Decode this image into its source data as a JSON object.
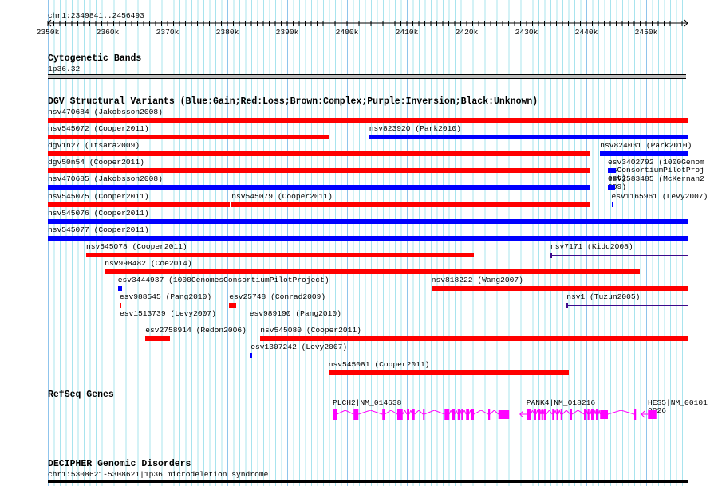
{
  "view": {
    "region_label": "chr1:2349841..2456493",
    "start_kb": 2349.841,
    "end_kb": 2456.493
  },
  "ruler": {
    "ticks": [
      "2350k",
      "2360k",
      "2370k",
      "2380k",
      "2390k",
      "2400k",
      "2410k",
      "2420k",
      "2430k",
      "2440k",
      "2450k"
    ]
  },
  "colors": {
    "gain": "#0000ff",
    "loss": "#ff0000",
    "inversion": "#3c0a8c",
    "gene": "#ff00ff",
    "grid_major": "#8fc4ec",
    "grid_minor": "#a8e4ee"
  },
  "tracks": {
    "cyto": {
      "title": "Cytogenetic Bands",
      "band": "1p36.32"
    },
    "dgv": {
      "title": "DGV Structural Variants (Blue:Gain;Red:Loss;Brown:Complex;Purple:Inversion;Black:Unknown)",
      "rows": [
        [
          {
            "label": "nsv470684 (Jakobsson2008)",
            "start": 2349.8,
            "end": 2457,
            "type": "loss"
          }
        ],
        [
          {
            "label": "nsv545072 (Cooper2011)",
            "start": 2349.8,
            "end": 2397.1,
            "type": "loss"
          },
          {
            "label": "nsv823920 (Park2010)",
            "start": 2403.7,
            "end": 2457,
            "type": "gain"
          }
        ],
        [
          {
            "label": "dgv1n27 (Itsara2009)",
            "start": 2349.8,
            "end": 2440.5,
            "type": "loss"
          },
          {
            "label": "nsv824031 (Park2010)",
            "start": 2442.3,
            "end": 2457,
            "type": "gain"
          }
        ],
        [
          {
            "label": "dgv50n54 (Cooper2011)",
            "start": 2349.8,
            "end": 2440.5,
            "type": "loss"
          },
          {
            "label": "esv3402792 (1000GenomesConsortiumPilotProject)",
            "start": 2443.6,
            "end": 2444.9,
            "type": "gain"
          }
        ],
        [
          {
            "label": "nsv470685 (Jakobsson2008)",
            "start": 2349.8,
            "end": 2440.5,
            "type": "gain"
          },
          {
            "label": "esv2583485 (McKernan2009)",
            "start": 2443.6,
            "end": 2444.8,
            "type": "gain"
          }
        ],
        [
          {
            "label": "nsv545075 (Cooper2011)",
            "start": 2349.8,
            "end": 2380.4,
            "type": "loss"
          },
          {
            "label": "nsv545079 (Cooper2011)",
            "start": 2380.7,
            "end": 2440.5,
            "type": "loss"
          },
          {
            "label": "esv1165961 (Levy2007)",
            "start": 2444.2,
            "end": 2444.5,
            "type": "gain"
          }
        ],
        [
          {
            "label": "nsv545076 (Cooper2011)",
            "start": 2349.8,
            "end": 2457,
            "type": "gain"
          }
        ],
        [
          {
            "label": "nsv545077 (Cooper2011)",
            "start": 2349.8,
            "end": 2457,
            "type": "gain"
          }
        ],
        [
          {
            "label": "nsv545078 (Cooper2011)",
            "start": 2356.4,
            "end": 2421.2,
            "type": "loss"
          },
          {
            "label": "nsv7171 (Kidd2008)",
            "start": 2434.0,
            "end": 2457,
            "type": "inversion"
          }
        ],
        [
          {
            "label": "nsv998482 (Coe2014)",
            "start": 2359.5,
            "end": 2448.9,
            "type": "loss"
          }
        ],
        [
          {
            "label": "esv3444937 (1000GenomesConsortiumPilotProject)",
            "start": 2361.7,
            "end": 2362.4,
            "type": "gain"
          },
          {
            "label": "nsv818222 (Wang2007)",
            "start": 2414.1,
            "end": 2457,
            "type": "loss"
          }
        ],
        [
          {
            "label": "esv988545 (Pang2010)",
            "start": 2362.0,
            "end": 2362.3,
            "type": "loss"
          },
          {
            "label": "esv25748 (Conrad2009)",
            "start": 2380.3,
            "end": 2381.5,
            "type": "loss"
          },
          {
            "label": "nsv1 (Tuzun2005)",
            "start": 2436.7,
            "end": 2457,
            "type": "inversion"
          }
        ],
        [
          {
            "label": "esv1513739 (Levy2007)",
            "start": 2362.0,
            "end": 2362.2,
            "type": "gain"
          },
          {
            "label": "esv989190 (Pang2010)",
            "start": 2383.7,
            "end": 2383.9,
            "type": "gain"
          }
        ],
        [
          {
            "label": "esv2758914 (Redon2006)",
            "start": 2366.3,
            "end": 2370.4,
            "type": "loss"
          },
          {
            "label": "nsv545080 (Cooper2011)",
            "start": 2385.5,
            "end": 2457,
            "type": "loss"
          }
        ],
        [
          {
            "label": "esv1307242 (Levy2007)",
            "start": 2383.9,
            "end": 2384.1,
            "type": "gain"
          }
        ],
        [
          {
            "label": "nsv545081 (Cooper2011)",
            "start": 2396.9,
            "end": 2437.0,
            "type": "loss"
          }
        ]
      ]
    },
    "refseq": {
      "title": "RefSeq Genes",
      "genes": [
        {
          "label": "PLCH2|NM_014638",
          "strand": "+",
          "exons": [
            [
              2397.6,
              2398.3
            ],
            [
              2401.1,
              2401.9
            ],
            [
              2405.9,
              2406.3
            ],
            [
              2408.4,
              2409.3
            ],
            [
              2410.0,
              2410.4
            ],
            [
              2410.9,
              2411.3
            ],
            [
              2412.7,
              2412.9
            ],
            [
              2416.3,
              2417.1
            ],
            [
              2417.6,
              2418.0
            ],
            [
              2418.5,
              2418.8
            ],
            [
              2419.1,
              2419.3
            ],
            [
              2419.9,
              2420.4
            ],
            [
              2420.8,
              2421.2
            ],
            [
              2423.6,
              2423.9
            ],
            [
              2425.3,
              2427.1
            ]
          ]
        },
        {
          "label": "PANK4|NM_018216",
          "strand": "-",
          "exons": [
            [
              2430.0,
              2430.7
            ],
            [
              2431.3,
              2431.6
            ],
            [
              2432.0,
              2432.3
            ],
            [
              2432.5,
              2432.7
            ],
            [
              2432.9,
              2433.3
            ],
            [
              2434.3,
              2434.6
            ],
            [
              2435.0,
              2435.3
            ],
            [
              2435.7,
              2436.0
            ],
            [
              2437.3,
              2437.6
            ],
            [
              2439.6,
              2439.9
            ],
            [
              2440.2,
              2440.5
            ],
            [
              2440.8,
              2441.3
            ],
            [
              2441.6,
              2442.0
            ],
            [
              2442.3,
              2443.6
            ],
            [
              2448.0,
              2448.3
            ]
          ],
          "tx_start": 2428.9
        },
        {
          "label": "HES5|NM_001010926",
          "strand": "-",
          "exons": [
            [
              2450.3,
              2451.7
            ]
          ],
          "tx_start": 2449.2
        }
      ]
    },
    "decipher": {
      "title": "DECIPHER Genomic Disorders",
      "feature": "chr1:5308621-5308621|1p36 microdeletion syndrome"
    }
  }
}
